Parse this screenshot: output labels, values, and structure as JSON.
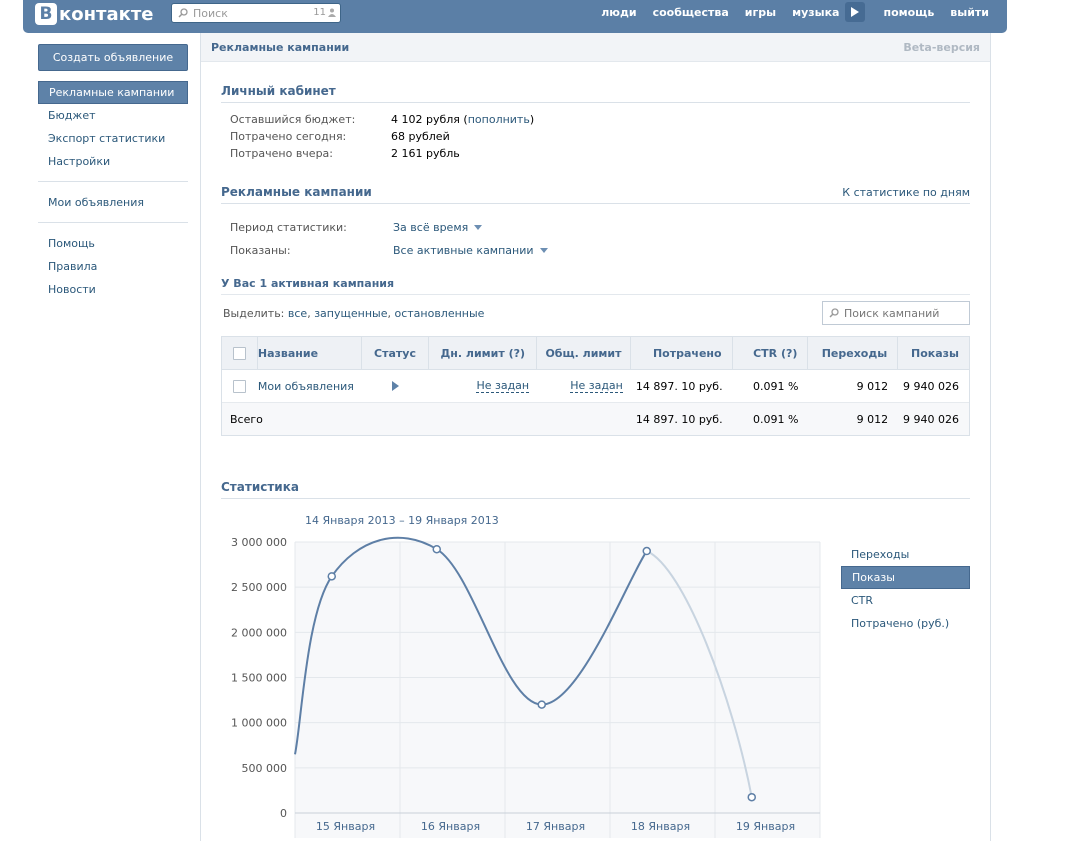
{
  "header": {
    "logo_letter": "В",
    "logo_word": "контакте",
    "search_placeholder": "Поиск",
    "search_count": "11",
    "nav": [
      "люди",
      "сообщества",
      "игры",
      "музыка",
      "помощь",
      "выйти"
    ]
  },
  "sidebar": {
    "create_button": "Создать объявление",
    "group1": [
      "Рекламные кампании",
      "Бюджет",
      "Экспорт статистики",
      "Настройки"
    ],
    "group2": [
      "Мои объявления"
    ],
    "group3": [
      "Помощь",
      "Правила",
      "Новости"
    ]
  },
  "main": {
    "title": "Рекламные кампании",
    "beta": "Beta-версия",
    "cabinet": {
      "title": "Личный кабинет",
      "budget_label": "Оставшийся бюджет:",
      "budget_value": "4 102 рубля",
      "budget_link_open": "(",
      "budget_link": "пополнить",
      "budget_link_close": ")",
      "today_label": "Потрачено сегодня:",
      "today_value": "68 рублей",
      "yesterday_label": "Потрачено вчера:",
      "yesterday_value": "2 161 рубль"
    },
    "campaigns": {
      "title": "Рекламные кампании",
      "daily_link": "К статистике по дням",
      "period_label": "Период статистики:",
      "period_value": "За всё время",
      "shown_label": "Показаны:",
      "shown_value": "Все активные кампании",
      "active_count": "У Вас 1 активная кампания",
      "select_label": "Выделить:",
      "select_all": "все",
      "select_running": "запущенные",
      "select_stopped": "остановленные",
      "search_placeholder": "Поиск кампаний"
    },
    "table": {
      "headers": {
        "name": "Название",
        "status": "Статус",
        "daily_limit": "Дн. лимит (?)",
        "total_limit": "Общ. лимит",
        "spent": "Потрачено",
        "ctr": "CTR (?)",
        "clicks": "Переходы",
        "impressions": "Показы"
      },
      "rows": [
        {
          "name": "Мои объявления",
          "daily_limit": "Не задан",
          "total_limit": "Не задан",
          "spent": "14 897. 10 руб.",
          "ctr": "0.091 %",
          "clicks": "9 012",
          "impressions": "9 940 026"
        }
      ],
      "total": {
        "label": "Всего",
        "spent": "14 897. 10 руб.",
        "ctr": "0.091 %",
        "clicks": "9 012",
        "impressions": "9 940 026"
      }
    },
    "stats": {
      "title": "Статистика",
      "legend": [
        "Переходы",
        "Показы",
        "CTR",
        "Потрачено (руб.)"
      ],
      "legend_active": 1
    }
  },
  "chart_data": {
    "type": "line",
    "title": "14 Января 2013 – 19 Января 2013",
    "categories": [
      "15 Января",
      "16 Января",
      "17 Января",
      "18 Января",
      "19 Января"
    ],
    "y_ticks": [
      "0",
      "500 000",
      "1 000 000",
      "1 500 000",
      "2 000 000",
      "2 500 000",
      "3 000 000"
    ],
    "ylim": [
      0,
      3000000
    ],
    "series": [
      {
        "name": "Показы",
        "points": [
          {
            "x": "14 Января",
            "y": 650000
          },
          {
            "x": "15 Января",
            "y": 2620000
          },
          {
            "x": "16 Января",
            "y": 2920000
          },
          {
            "x": "17 Января",
            "y": 1200000
          },
          {
            "x": "18 Января",
            "y": 2900000
          },
          {
            "x": "19 Января",
            "y": 175000
          }
        ]
      }
    ],
    "colors": {
      "line": "#5e7fa6",
      "line_faded": "#c8d4e0",
      "grid": "#e4e8ec",
      "plot_bg": "#f7f8fa"
    },
    "grid": true
  }
}
